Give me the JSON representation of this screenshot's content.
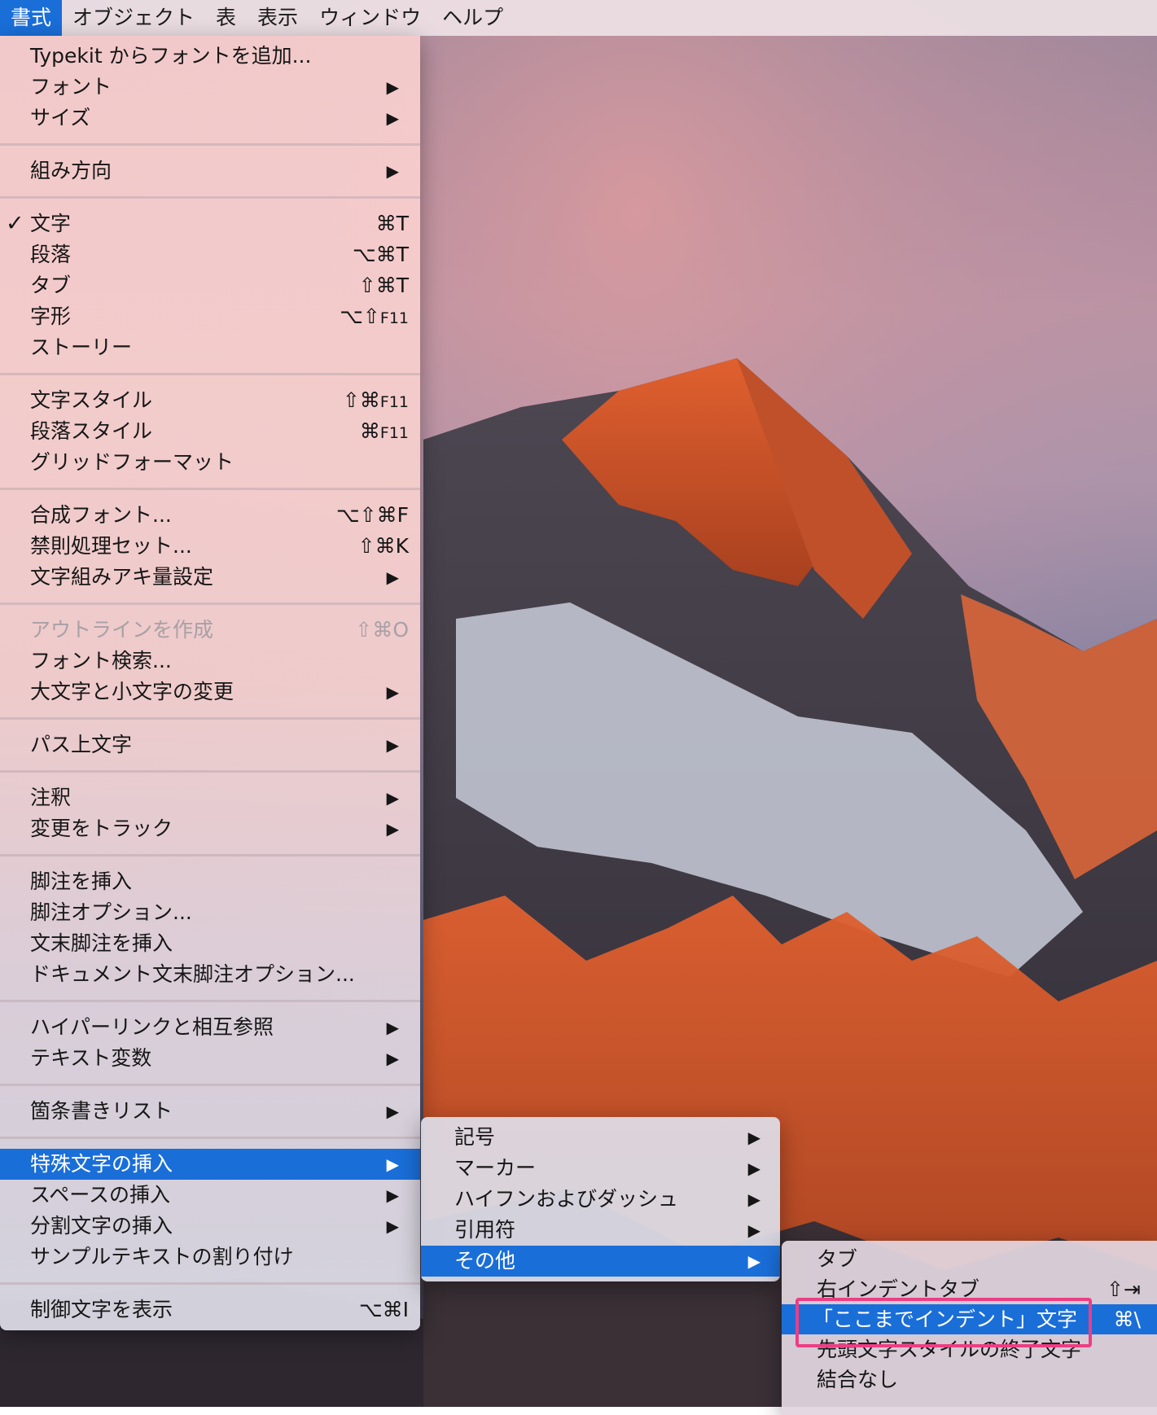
{
  "menubar": {
    "items": [
      "書式",
      "オブジェクト",
      "表",
      "表示",
      "ウィンドウ",
      "ヘルプ"
    ],
    "active_index": 0
  },
  "format_menu": {
    "items": [
      {
        "label": "Typekit からフォントを追加..."
      },
      {
        "label": "フォント",
        "submenu": true
      },
      {
        "label": "サイズ",
        "submenu": true
      },
      {
        "separator": true
      },
      {
        "label": "組み方向",
        "submenu": true
      },
      {
        "separator": true
      },
      {
        "label": "文字",
        "shortcut": "⌘T",
        "checked": true
      },
      {
        "label": "段落",
        "shortcut": "⌥⌘T"
      },
      {
        "label": "タブ",
        "shortcut": "⇧⌘T"
      },
      {
        "label": "字形",
        "shortcut": "⌥⇧F11"
      },
      {
        "label": "ストーリー"
      },
      {
        "separator": true
      },
      {
        "label": "文字スタイル",
        "shortcut": "⇧⌘F11"
      },
      {
        "label": "段落スタイル",
        "shortcut": "⌘F11"
      },
      {
        "label": "グリッドフォーマット"
      },
      {
        "separator": true
      },
      {
        "label": "合成フォント...",
        "shortcut": "⌥⇧⌘F"
      },
      {
        "label": "禁則処理セット...",
        "shortcut": "⇧⌘K"
      },
      {
        "label": "文字組みアキ量設定",
        "submenu": true
      },
      {
        "separator": true
      },
      {
        "label": "アウトラインを作成",
        "shortcut": "⇧⌘O",
        "disabled": true
      },
      {
        "label": "フォント検索..."
      },
      {
        "label": "大文字と小文字の変更",
        "submenu": true
      },
      {
        "separator": true
      },
      {
        "label": "パス上文字",
        "submenu": true
      },
      {
        "separator": true
      },
      {
        "label": "注釈",
        "submenu": true
      },
      {
        "label": "変更をトラック",
        "submenu": true
      },
      {
        "separator": true
      },
      {
        "label": "脚注を挿入"
      },
      {
        "label": "脚注オプション..."
      },
      {
        "label": "文末脚注を挿入"
      },
      {
        "label": "ドキュメント文末脚注オプション..."
      },
      {
        "separator": true
      },
      {
        "label": "ハイパーリンクと相互参照",
        "submenu": true
      },
      {
        "label": "テキスト変数",
        "submenu": true
      },
      {
        "separator": true
      },
      {
        "label": "箇条書きリスト",
        "submenu": true
      },
      {
        "separator": true
      },
      {
        "label": "特殊文字の挿入",
        "submenu": true,
        "selected": true
      },
      {
        "label": "スペースの挿入",
        "submenu": true
      },
      {
        "label": "分割文字の挿入",
        "submenu": true
      },
      {
        "label": "サンプルテキストの割り付け"
      },
      {
        "separator": true
      },
      {
        "label": "制御文字を表示",
        "shortcut": "⌥⌘I"
      }
    ]
  },
  "special_chars_menu": {
    "items": [
      {
        "label": "記号",
        "submenu": true
      },
      {
        "label": "マーカー",
        "submenu": true
      },
      {
        "label": "ハイフンおよびダッシュ",
        "submenu": true
      },
      {
        "label": "引用符",
        "submenu": true
      },
      {
        "label": "その他",
        "submenu": true,
        "selected": true
      }
    ]
  },
  "other_menu": {
    "items": [
      {
        "label": "タブ"
      },
      {
        "label": "右インデントタブ",
        "shortcut": "⇧⇥"
      },
      {
        "label": "「ここまでインデント」文字",
        "shortcut": "⌘\\",
        "selected": true
      },
      {
        "label": "先頭文字スタイルの終了文字"
      },
      {
        "label": "結合なし"
      }
    ]
  },
  "icons": {
    "submenu_arrow": "▶",
    "check": "✓"
  },
  "colors": {
    "accent": "#1a6ed8",
    "callout": "#ec3e84"
  }
}
